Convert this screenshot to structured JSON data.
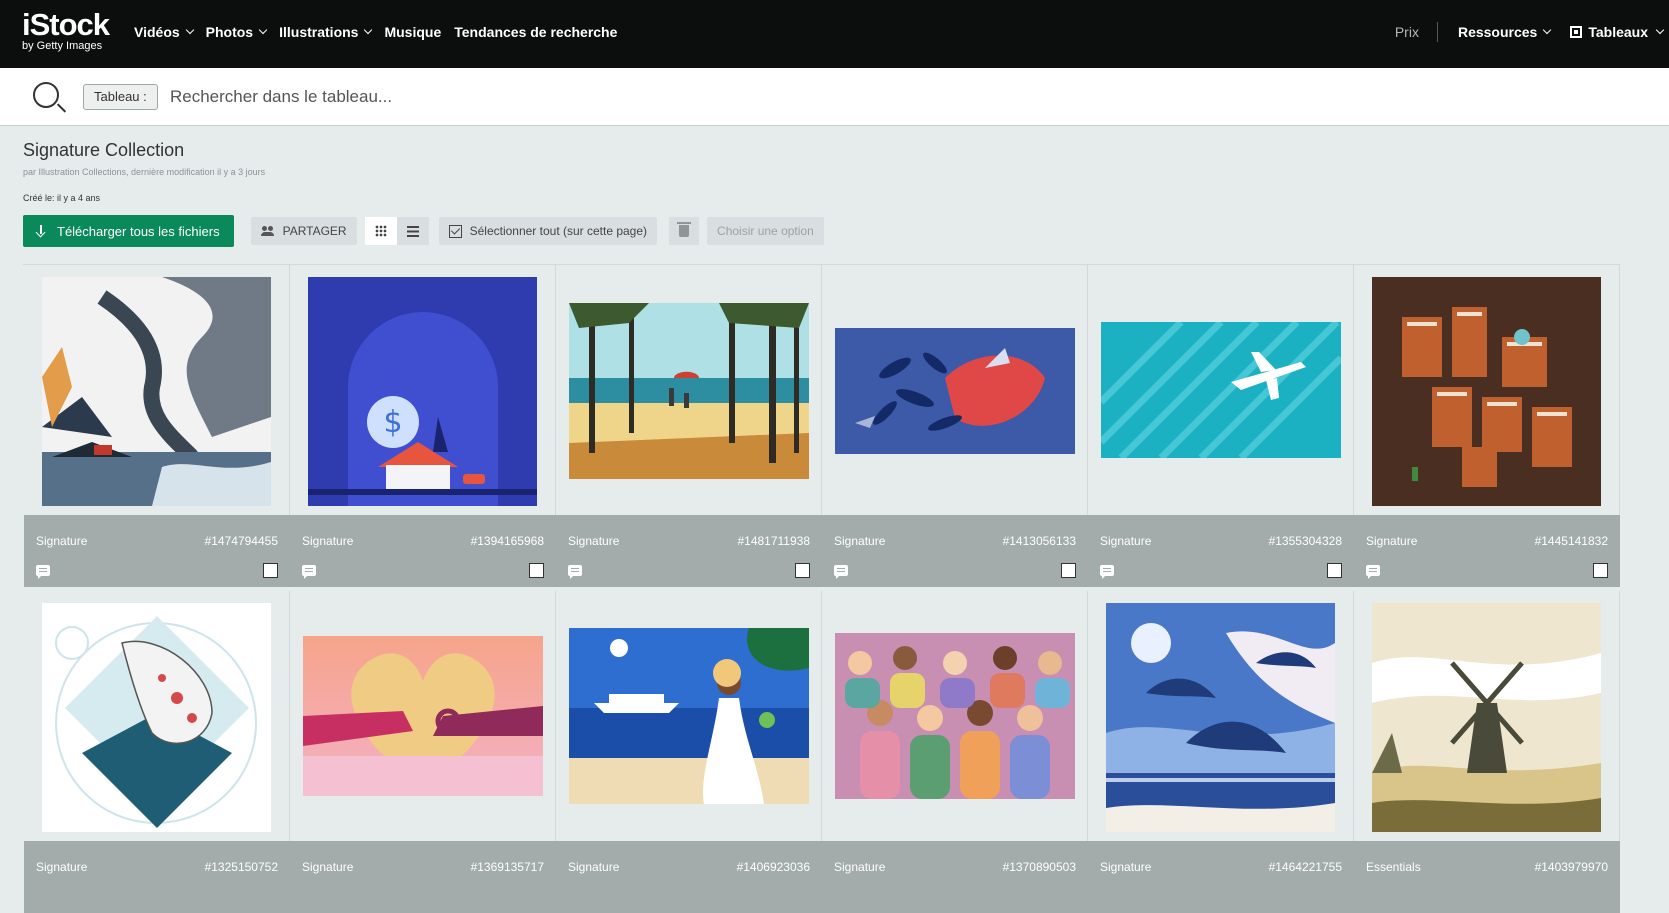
{
  "nav": {
    "logo_main": "iStock",
    "logo_sub": "by Getty Images",
    "items": [
      {
        "label": "Vidéos",
        "dropdown": true
      },
      {
        "label": "Photos",
        "dropdown": true
      },
      {
        "label": "Illustrations",
        "dropdown": true
      },
      {
        "label": "Musique",
        "dropdown": false
      },
      {
        "label": "Tendances de recherche",
        "dropdown": false
      }
    ],
    "prix": "Prix",
    "ressources": "Ressources",
    "tableaux": "Tableaux"
  },
  "search": {
    "chip": "Tableau :",
    "placeholder": "Rechercher dans le tableau..."
  },
  "board": {
    "title": "Signature Collection",
    "meta": "par Illustration Collections, dernière modification il y a 3 jours",
    "created": "Créé le: il y a 4 ans"
  },
  "toolbar": {
    "download": "Télécharger tous les fichiers",
    "share": "PARTAGER",
    "select_all": "Sélectionner tout (sur cette page)",
    "choose_option": "Choisir une option"
  },
  "colors": {
    "accent_green": "#0a8a5b",
    "nav_bg": "#0c0d0d",
    "footer_gray": "#a3abab"
  },
  "cards": [
    {
      "collection": "Signature",
      "id": "#1474794455",
      "thumb": "tornado-landscape"
    },
    {
      "collection": "Signature",
      "id": "#1394165968",
      "thumb": "house-dollar-coin"
    },
    {
      "collection": "Signature",
      "id": "#1481711938",
      "thumb": "beach-pine-trees"
    },
    {
      "collection": "Signature",
      "id": "#1413056133",
      "thumb": "red-dove-leaves"
    },
    {
      "collection": "Signature",
      "id": "#1355304328",
      "thumb": "airplane-city-names"
    },
    {
      "collection": "Signature",
      "id": "#1445141832",
      "thumb": "isometric-number-buildings"
    },
    {
      "collection": "Signature",
      "id": "#1325150752",
      "thumb": "koi-fish-pattern"
    },
    {
      "collection": "Signature",
      "id": "#1369135717",
      "thumb": "hands-heart"
    },
    {
      "collection": "Signature",
      "id": "#1406923036",
      "thumb": "cruise-woman-beach"
    },
    {
      "collection": "Signature",
      "id": "#1370890503",
      "thumb": "crowd-people"
    },
    {
      "collection": "Signature",
      "id": "#1464221755",
      "thumb": "manta-rays-sky"
    },
    {
      "collection": "Essentials",
      "id": "#1403979970",
      "thumb": "windmill-landscape"
    }
  ]
}
